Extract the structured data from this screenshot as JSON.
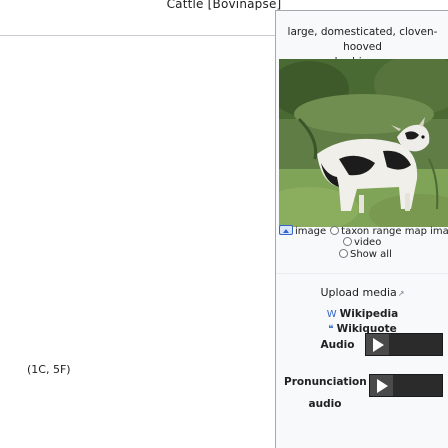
{
  "top_title": "Cattle [Bovinapse]",
  "left_note": "(1C, 5F)",
  "infobox": {
    "caption_line1": "large, domesticated, cloven-hooved",
    "caption_line2": "herbivores",
    "media_switcher": {
      "image": "image",
      "taxon_range_map": "taxon range map image",
      "video": "video",
      "show_all": "Show all"
    },
    "upload_media": "Upload media",
    "links": {
      "wikipedia": "Wikipedia",
      "wikiquote": "Wikiquote"
    },
    "audio_label": "Audio",
    "pronunciation_line1": "Pronunciation",
    "pronunciation_line2": "audio"
  }
}
